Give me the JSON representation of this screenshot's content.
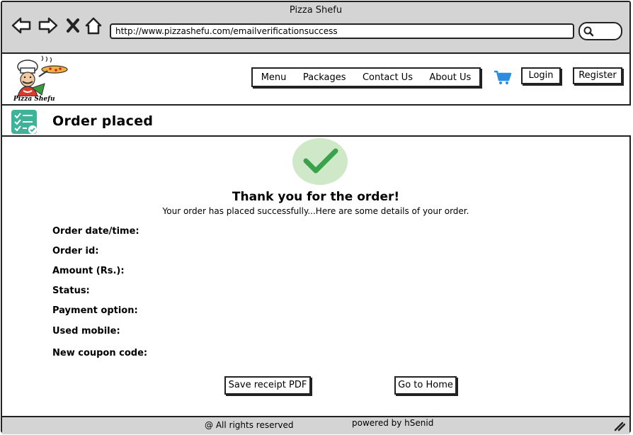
{
  "window": {
    "title": "Pizza Shefu"
  },
  "browser": {
    "url": "http://www.pizzashefu.com/emailverificationsuccess",
    "icons": [
      "back-icon",
      "forward-icon",
      "close-icon",
      "home-icon",
      "search-icon"
    ]
  },
  "header": {
    "logo_text": "Pizza Shefu",
    "nav": [
      "Menu",
      "Packages",
      "Contact Us",
      "About Us"
    ],
    "login_label": "Login",
    "register_label": "Register",
    "cart_icon": "cart-icon",
    "accent_color": "#2b8ce0"
  },
  "page": {
    "title": "Order placed",
    "title_icon": "checklist-icon",
    "success_icon": "checkmark-icon",
    "success_color": "#3aa24a",
    "heading": "Thank you for the order!",
    "subheading": "Your order has placed successfully...Here are some details of your order.",
    "details": [
      "Order date/time:",
      "Order id:",
      "Amount (Rs.):",
      "Status:",
      "Payment option:",
      "Used mobile:",
      "New coupon code:"
    ],
    "save_receipt_label": "Save receipt PDF",
    "go_home_label": "Go to Home"
  },
  "footer": {
    "rights": "@ All rights reserved",
    "powered_by": "powered by hSenid"
  }
}
